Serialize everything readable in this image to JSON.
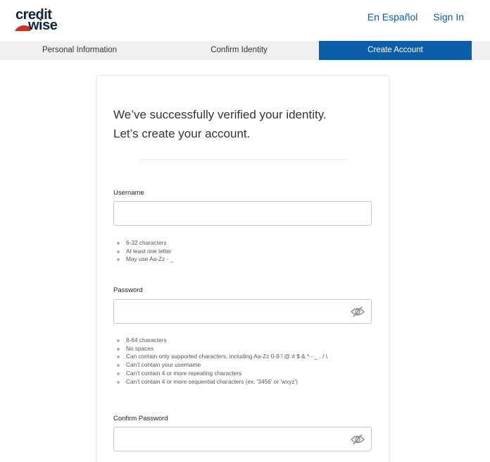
{
  "brand": {
    "logo_line1": "credit",
    "logo_line2": "wise",
    "accent_color": "#d22e1e",
    "navy_color": "#0d2440"
  },
  "header": {
    "links": [
      "En Español",
      "Sign In"
    ]
  },
  "steps": {
    "items": [
      "Personal Information",
      "Confirm Identity",
      "Create Account"
    ],
    "active_index": 2,
    "active_color": "#0a5da8"
  },
  "form": {
    "heading_line1": "We’ve successfully verified your identity.",
    "heading_line2": "Let’s create your account.",
    "username": {
      "label": "Username",
      "value": "",
      "rules": [
        "6-32 characters",
        "At least one letter",
        "May use Aa-Zz - _"
      ]
    },
    "password": {
      "label": "Password",
      "value": "",
      "visibility_icon": "eye-slash-icon",
      "rules": [
        "8-64 characters",
        "No spaces",
        "Can contain only supported characters, including Aa-Zz 0-9 ! @ # $ & * - _ . / \\",
        "Can’t contain your username",
        "Can’t contain 4 or more repeating characters",
        "Can’t contain 4 or more sequential characters (ex. '3456' or 'wxyz')"
      ]
    },
    "confirm_password": {
      "label": "Confirm Password",
      "value": "",
      "visibility_icon": "eye-slash-icon"
    }
  }
}
